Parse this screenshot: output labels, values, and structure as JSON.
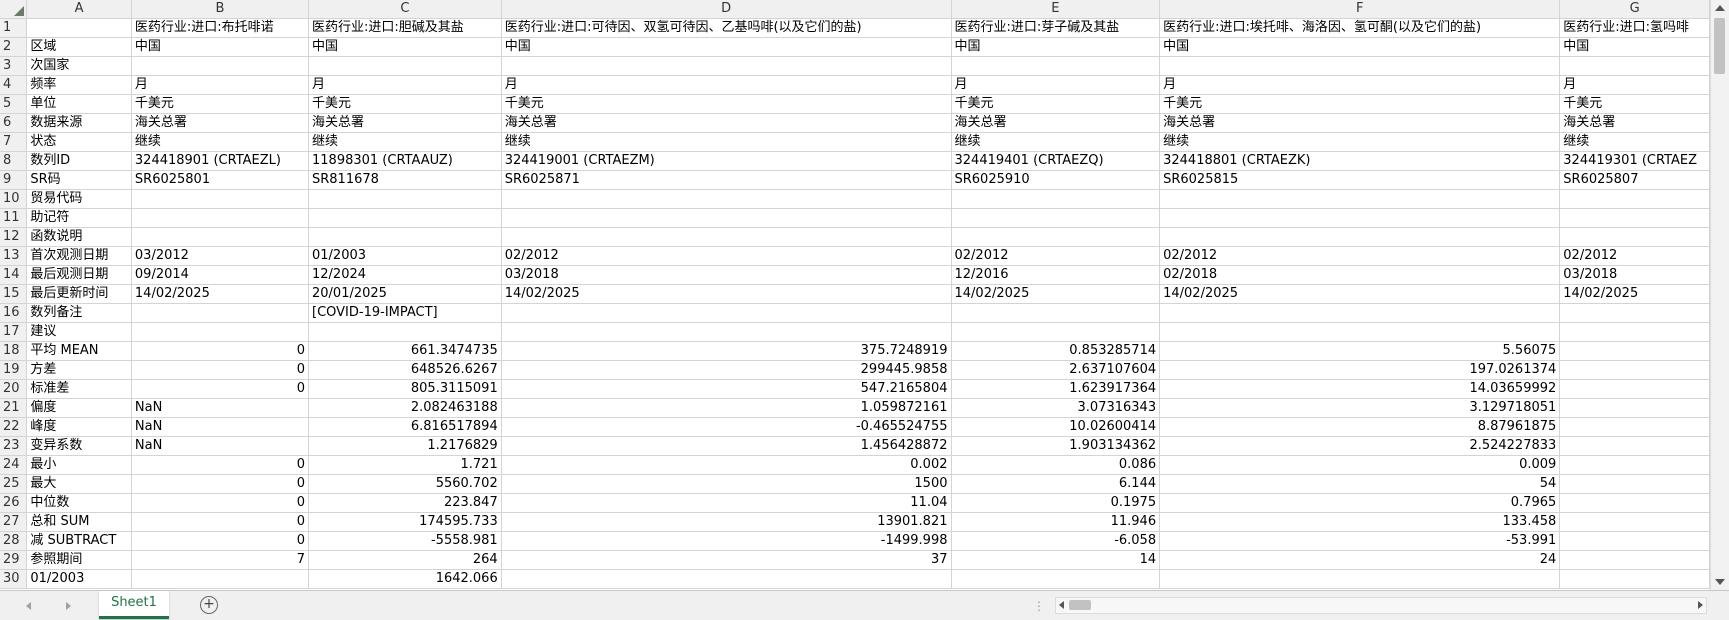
{
  "columns": [
    "A",
    "B",
    "C",
    "D",
    "E",
    "F",
    "G"
  ],
  "rows": [
    [
      "",
      "医药行业:进口:布托啡诺",
      "医药行业:进口:胆碱及其盐",
      "医药行业:进口:可待因、双氢可待因、乙基吗啡(以及它们的盐)",
      "医药行业:进口:芽子碱及其盐",
      "医药行业:进口:埃托啡、海洛因、氢可酮(以及它们的盐)",
      "医药行业:进口:氢吗啡"
    ],
    [
      "区域",
      "中国",
      "中国",
      "中国",
      "中国",
      "中国",
      "中国"
    ],
    [
      "次国家",
      "",
      "",
      "",
      "",
      "",
      ""
    ],
    [
      "频率",
      "月",
      "月",
      "月",
      "月",
      "月",
      "月"
    ],
    [
      "单位",
      "千美元",
      "千美元",
      "千美元",
      "千美元",
      "千美元",
      "千美元"
    ],
    [
      "数据来源",
      "海关总署",
      "海关总署",
      "海关总署",
      "海关总署",
      "海关总署",
      "海关总署"
    ],
    [
      "状态",
      "继续",
      "继续",
      "继续",
      "继续",
      "继续",
      "继续"
    ],
    [
      "数列ID",
      "324418901 (CRTAEZL)",
      "11898301 (CRTAAUZ)",
      "324419001 (CRTAEZM)",
      "324419401 (CRTAEZQ)",
      "324418801 (CRTAEZK)",
      "324419301 (CRTAEZ"
    ],
    [
      "SR码",
      "SR6025801",
      "SR811678",
      "SR6025871",
      "SR6025910",
      "SR6025815",
      "SR6025807"
    ],
    [
      "贸易代码",
      "",
      "",
      "",
      "",
      "",
      ""
    ],
    [
      "助记符",
      "",
      "",
      "",
      "",
      "",
      ""
    ],
    [
      "函数说明",
      "",
      "",
      "",
      "",
      "",
      ""
    ],
    [
      "首次观测日期",
      "03/2012",
      "01/2003",
      "02/2012",
      "02/2012",
      "02/2012",
      "02/2012"
    ],
    [
      "最后观测日期",
      "09/2014",
      "12/2024",
      "03/2018",
      "12/2016",
      "02/2018",
      "03/2018"
    ],
    [
      "最后更新时间",
      "14/02/2025",
      "20/01/2025",
      "14/02/2025",
      "14/02/2025",
      "14/02/2025",
      "14/02/2025"
    ],
    [
      "数列备注",
      "",
      "[COVID-19-IMPACT]",
      "",
      "",
      "",
      ""
    ],
    [
      "建议",
      "",
      "",
      "",
      "",
      "",
      ""
    ],
    [
      "平均 MEAN",
      "0",
      "661.3474735",
      "375.7248919",
      "0.853285714",
      "5.56075",
      ""
    ],
    [
      "方差",
      "0",
      "648526.6267",
      "299445.9858",
      "2.637107604",
      "197.0261374",
      ""
    ],
    [
      "标准差",
      "0",
      "805.3115091",
      "547.2165804",
      "1.623917364",
      "14.03659992",
      ""
    ],
    [
      "偏度",
      "NaN",
      "2.082463188",
      "1.059872161",
      "3.07316343",
      "3.129718051",
      ""
    ],
    [
      "峰度",
      "NaN",
      "6.816517894",
      "-0.465524755",
      "10.02600414",
      "8.87961875",
      ""
    ],
    [
      "变异系数",
      "NaN",
      "1.2176829",
      "1.456428872",
      "1.903134362",
      "2.524227833",
      ""
    ],
    [
      "最小",
      "0",
      "1.721",
      "0.002",
      "0.086",
      "0.009",
      ""
    ],
    [
      "最大",
      "0",
      "5560.702",
      "1500",
      "6.144",
      "54",
      ""
    ],
    [
      "中位数",
      "0",
      "223.847",
      "11.04",
      "0.1975",
      "0.7965",
      ""
    ],
    [
      "总和 SUM",
      "0",
      "174595.733",
      "13901.821",
      "11.946",
      "133.458",
      ""
    ],
    [
      "减 SUBTRACT",
      "0",
      "-5558.981",
      "-1499.998",
      "-6.058",
      "-53.991",
      ""
    ],
    [
      "参照期间",
      "7",
      "264",
      "37",
      "14",
      "24",
      ""
    ],
    [
      "01/2003",
      "",
      "1642.066",
      "",
      "",
      "",
      ""
    ]
  ],
  "sheet_tab": "Sheet1",
  "add_sheet_label": "+",
  "tab_separator": "⋮"
}
